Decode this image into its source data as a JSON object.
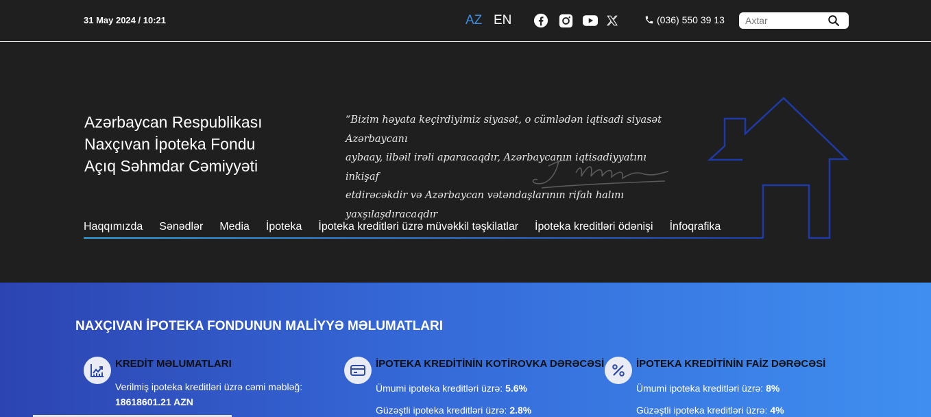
{
  "topbar": {
    "datetime": "31 May 2024 / 10:21",
    "languages": [
      "AZ",
      "EN"
    ],
    "active_language": "AZ",
    "social_icons": [
      "facebook-icon",
      "instagram-icon",
      "youtube-icon",
      "x-icon"
    ],
    "phone": "(036) 550 39 13",
    "search_placeholder": "Axtar"
  },
  "hero": {
    "org_title_lines": [
      "Azərbaycan Respublikası",
      "Naxçıvan İpoteka Fondu",
      "Açıq Səhmdar Cəmiyyəti"
    ],
    "quote_lines": [
      "“Bizim həyata keçirdiyimiz siyasət, o cümlədən iqtisadi siyasət Azərbaycanı",
      "aybaay, ilbəil irəli aparacaqdır, Azərbaycanın iqtisadiyyatını inkişaf",
      "etdirəcəkdir və Azərbaycan vətəndaşlarının rifah halını yaxşılaşdıracaqdır"
    ]
  },
  "nav": {
    "items": [
      "Haqqımızda",
      "Sənədlər",
      "Media",
      "İpoteka",
      "İpoteka kreditləri üzrə müvəkkil təşkilatlar",
      "İpoteka kreditləri ödənişi",
      "İnfoqrafika"
    ]
  },
  "finance": {
    "title": "NAXÇIVAN İPOTEKA FONDUNUN MALİYYƏ MƏLUMATLARI",
    "cards": [
      {
        "icon": "chart-trend-icon",
        "title": "KREDİT MƏLUMATLARI",
        "line1_label": "Verilmiş ipoteka kreditləri üzrə cəmi məbləğ:",
        "line1_value": "18618601.21 AZN"
      },
      {
        "icon": "credit-card-icon",
        "title": "İPOTEKA KREDİTİNİN KOTİROVKA DƏRƏCƏSİ",
        "line1_label": "Ümumi ipoteka kreditləri üzrə:",
        "line1_value": "5.6%",
        "line2_label": "Güzəştli ipoteka kreditləri üzrə:",
        "line2_value": "2.8%"
      },
      {
        "icon": "percent-icon",
        "title": "İPOTEKA KREDİTİNİN FAİZ DƏRƏCƏSİ",
        "line1_label": "Ümumi ipoteka kreditləri üzrə:",
        "line1_value": "8%",
        "line2_label": "Güzəştli ipoteka kreditləri üzrə:",
        "line2_value": "4%"
      }
    ]
  },
  "colors": {
    "background": "#1f1f1f",
    "accent_blue": "#3d8de0",
    "finance_gradient_start": "#2c44b1",
    "finance_gradient_end": "#3f8ff0"
  }
}
